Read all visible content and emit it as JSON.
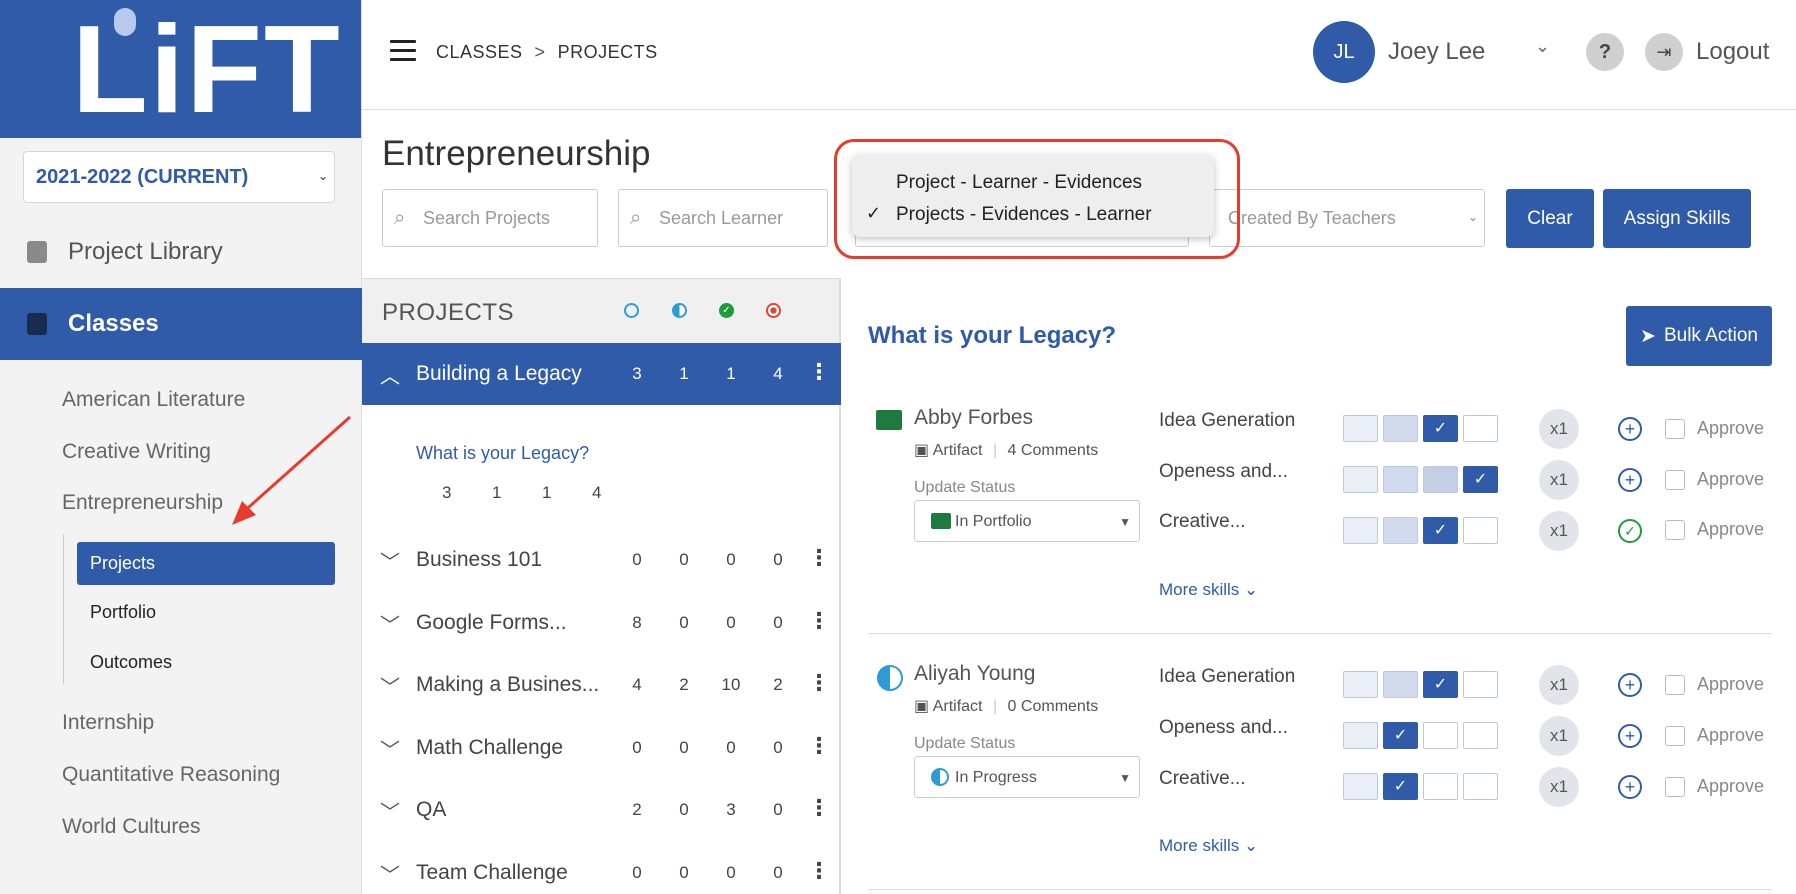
{
  "brand": {
    "logo_text": "LiFT"
  },
  "sidebar": {
    "year": "2021-2022 (CURRENT)",
    "nav": [
      {
        "label": "Project Library"
      },
      {
        "label": "Classes"
      }
    ],
    "classes": [
      "American Literature",
      "Creative Writing",
      "Entrepreneurship",
      "Internship",
      "Quantitative Reasoning",
      "World Cultures"
    ],
    "sub_items": [
      "Projects",
      "Portfolio",
      "Outcomes"
    ]
  },
  "header": {
    "breadcrumb": [
      "CLASSES",
      "PROJECTS"
    ],
    "breadcrumb_sep": ">",
    "user_initials": "JL",
    "user_name": "Joey Lee",
    "help": "?",
    "logout": "Logout"
  },
  "page": {
    "title": "Entrepreneurship",
    "search_projects": "Search Projects",
    "search_learner": "Search Learner",
    "created_by": "Created By Teachers",
    "clear": "Clear",
    "assign_skills": "Assign Skills"
  },
  "view_popup": {
    "options": [
      "Project - Learner - Evidences",
      "Projects - Evidences - Learner"
    ],
    "selected_mark": "✓"
  },
  "projects": {
    "header": "PROJECTS",
    "status_colors": [
      "#2f9bd6",
      "#2f9bd6",
      "#1f9b3a",
      "#e0452f"
    ],
    "rows": [
      {
        "name": "Building a Legacy",
        "counts": [
          "3",
          "1",
          "1",
          "4"
        ]
      },
      {
        "name": "Business 101",
        "counts": [
          "0",
          "0",
          "0",
          "0"
        ]
      },
      {
        "name": "Google Forms...",
        "counts": [
          "8",
          "0",
          "0",
          "0"
        ]
      },
      {
        "name": "Making a Busines...",
        "counts": [
          "4",
          "2",
          "10",
          "2"
        ]
      },
      {
        "name": "Math Challenge",
        "counts": [
          "0",
          "0",
          "0",
          "0"
        ]
      },
      {
        "name": "QA",
        "counts": [
          "2",
          "0",
          "3",
          "0"
        ]
      },
      {
        "name": "Team Challenge",
        "counts": [
          "0",
          "0",
          "0",
          "0"
        ]
      }
    ],
    "sub_project": {
      "name": "What is your Legacy?",
      "counts": [
        "3",
        "1",
        "1",
        "4"
      ]
    }
  },
  "detail": {
    "title": "What is your Legacy?",
    "bulk_action": "Bulk Action",
    "update_status_label": "Update Status",
    "more_skills": "More skills",
    "approve": "Approve",
    "x1": "x1",
    "artifact": "Artifact",
    "comments_word": "Comments",
    "learners": [
      {
        "name": "Abby Forbes",
        "comments": "4",
        "status": "In Portfolio",
        "skills": [
          "Idea Generation",
          "Openess and...",
          "Creative..."
        ]
      },
      {
        "name": "Aliyah Young",
        "comments": "0",
        "status": "In Progress",
        "skills": [
          "Idea Generation",
          "Openess and...",
          "Creative..."
        ]
      }
    ]
  },
  "colors": {
    "primary": "#2f5ba8",
    "highlight": "#e83b2f",
    "portfolio_green": "#1e7a3e"
  }
}
